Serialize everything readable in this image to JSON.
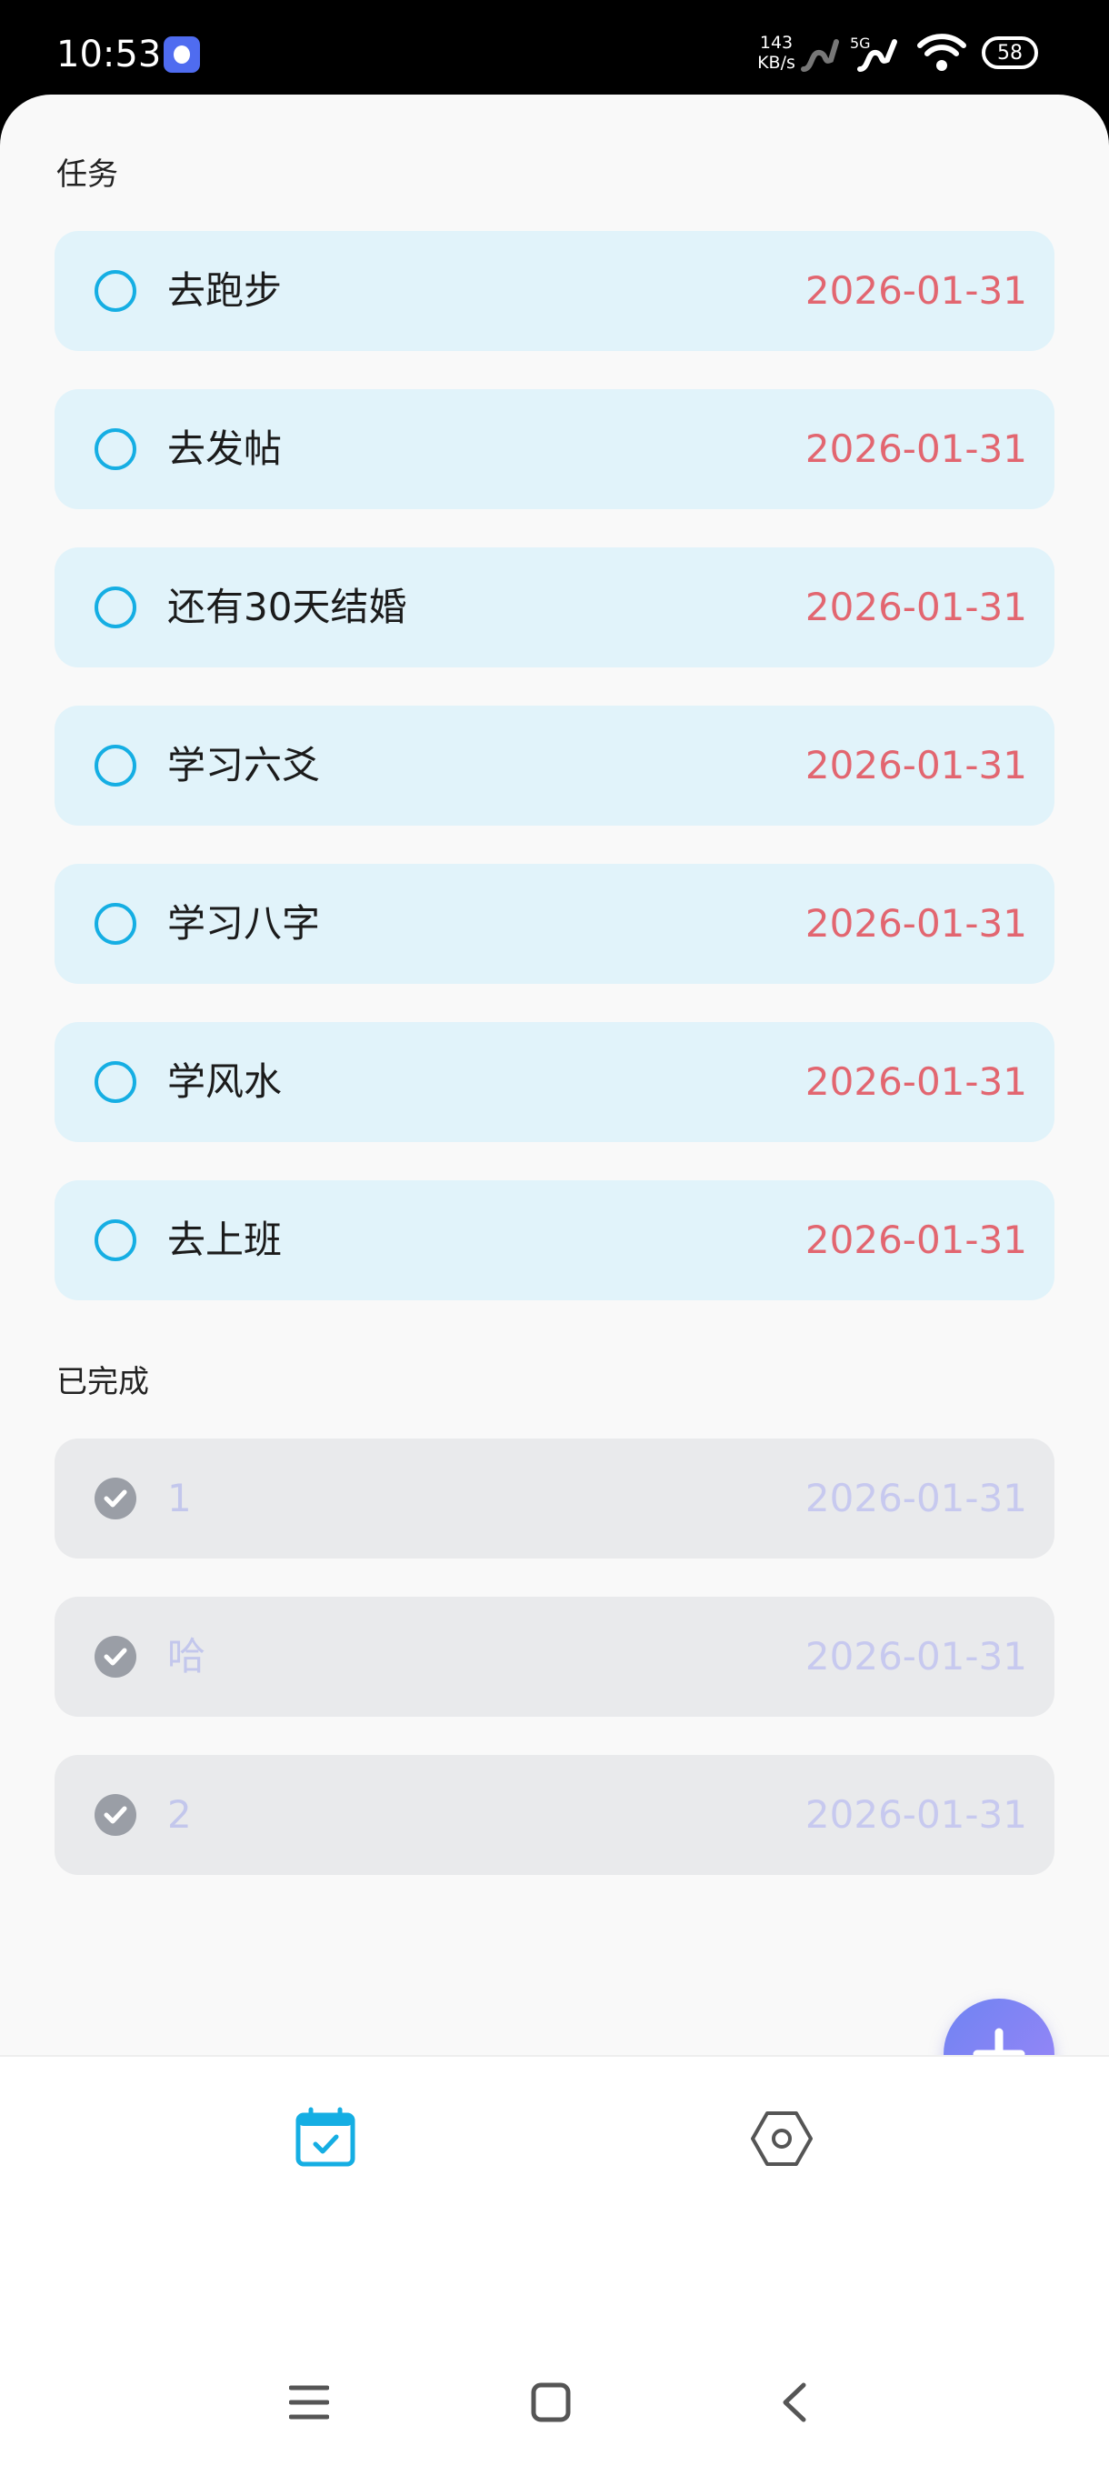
{
  "status_bar": {
    "time": "10:53",
    "speed_value": "143",
    "speed_unit": "KB/s",
    "network": "5G",
    "battery": "58"
  },
  "sections": {
    "pending_title": "任务",
    "done_title": "已完成"
  },
  "tasks": [
    {
      "title": "去跑步",
      "date": "2026-01-31"
    },
    {
      "title": "去发帖",
      "date": "2026-01-31"
    },
    {
      "title": "还有30天结婚",
      "date": "2026-01-31"
    },
    {
      "title": "学习六爻",
      "date": "2026-01-31"
    },
    {
      "title": "学习八字",
      "date": "2026-01-31"
    },
    {
      "title": "学风水",
      "date": "2026-01-31"
    },
    {
      "title": "去上班",
      "date": "2026-01-31"
    }
  ],
  "completed": [
    {
      "title": "1",
      "date": "2026-01-31"
    },
    {
      "title": "哈",
      "date": "2026-01-31"
    },
    {
      "title": "2",
      "date": "2026-01-31"
    }
  ],
  "icons": {
    "fab": "plus-icon",
    "nav_tasks": "calendar-check-icon",
    "nav_settings": "settings-hexagon-icon",
    "sys_menu": "menu-icon",
    "sys_home": "home-square-icon",
    "sys_back": "back-chevron-icon"
  },
  "colors": {
    "accent": "#15aee3",
    "task_bg": "#e1f3fa",
    "done_bg": "#e9eaec",
    "date_red": "#e26670",
    "fab_gradient_start": "#6f83f2",
    "fab_gradient_end": "#9c86f7"
  }
}
